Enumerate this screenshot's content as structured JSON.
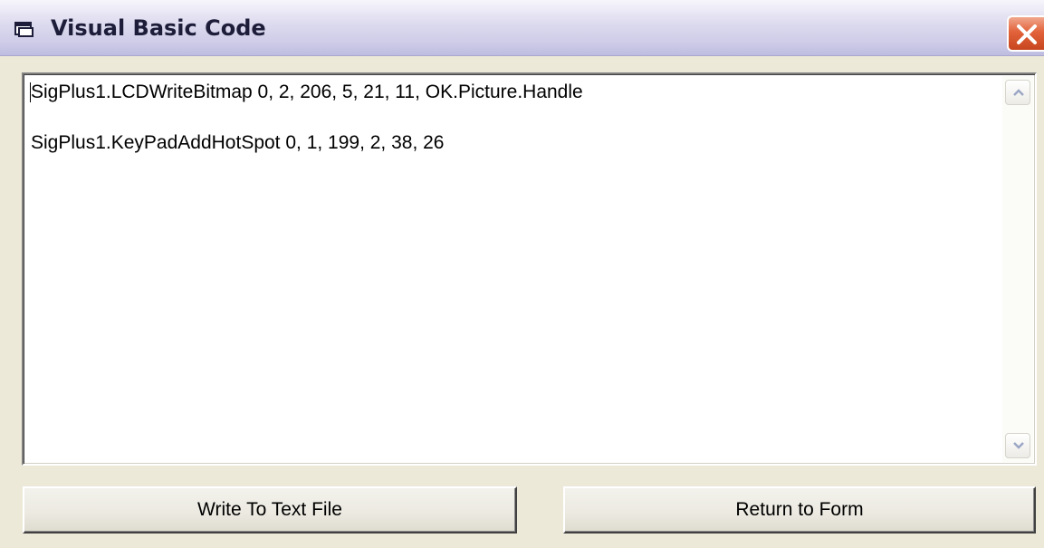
{
  "window": {
    "title": "Visual Basic Code",
    "close_label": "Close"
  },
  "code": {
    "lines": [
      "SigPlus1.LCDWriteBitmap 0, 2, 206, 5, 21, 11, OK.Picture.Handle",
      "",
      "SigPlus1.KeyPadAddHotSpot 0, 1, 199, 2, 38, 26"
    ]
  },
  "buttons": {
    "write_label": "Write To Text File",
    "return_label": "Return to Form"
  },
  "icons": {
    "title_icon": "form-window-icon",
    "close_icon": "close-x-icon",
    "scroll_up_icon": "chevron-up-icon",
    "scroll_down_icon": "chevron-down-icon"
  },
  "colors": {
    "face": "#ece9d8",
    "close_red": "#e2623a",
    "title_text": "#1d1d3a"
  }
}
